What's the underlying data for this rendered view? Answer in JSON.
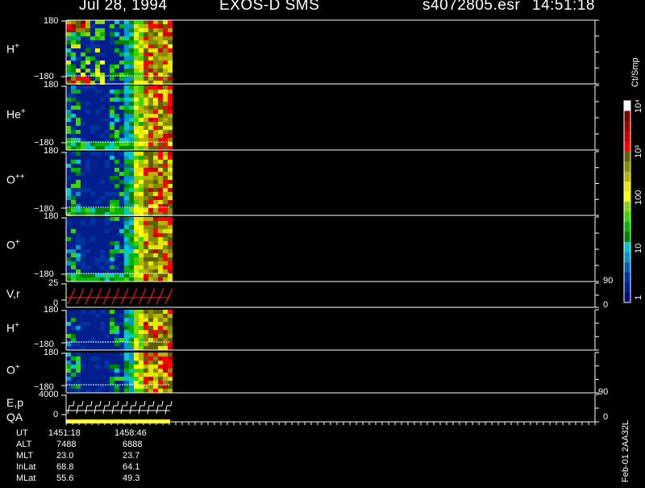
{
  "header": {
    "date": "Jul 28, 1994",
    "instrument": "EXOS-D SMS",
    "file": "s4072805.esr",
    "time": "14:51:18"
  },
  "panels": [
    {
      "id": "h-plus",
      "species": "H",
      "charge": "+",
      "y_top": "180",
      "y_bottom": "−180"
    },
    {
      "id": "he-plus",
      "species": "He",
      "charge": "+",
      "y_top": "180",
      "y_bottom": "−180"
    },
    {
      "id": "o-plusplus",
      "species": "O",
      "charge": "++",
      "y_top": "180",
      "y_bottom": "−180"
    },
    {
      "id": "o-plus",
      "species": "O",
      "charge": "+",
      "y_top": "180",
      "y_bottom": "−180",
      "right_tick": "90"
    },
    {
      "id": "vr",
      "species": "V,r",
      "charge": "",
      "y_top": "25",
      "y_bottom": "0",
      "right_tick": "0"
    },
    {
      "id": "h-plus-2",
      "species": "H",
      "charge": "+",
      "y_top": "180",
      "y_bottom": "−180"
    },
    {
      "id": "o-plus-2",
      "species": "O",
      "charge": "+",
      "y_top": "180",
      "y_bottom": "−180",
      "right_tick": "90"
    },
    {
      "id": "ep-qa",
      "species": "E,p",
      "species2": "QA",
      "charge": "",
      "y_top": "4000",
      "y_bottom": "0",
      "right_tick": "0"
    }
  ],
  "colorbar": {
    "unit": "Ct/Smp",
    "tick_labels": [
      "10⁴",
      "10³",
      "100",
      "10",
      "1"
    ],
    "colors": [
      "#ffffff",
      "#7a0000",
      "#a00000",
      "#c80000",
      "#ff0000",
      "#606000",
      "#8a8a00",
      "#b4b400",
      "#e6e600",
      "#ffff00",
      "#8ad400",
      "#3cd400",
      "#00b400",
      "#008200",
      "#00c8c8",
      "#0096c8",
      "#0064b4",
      "#0032a0",
      "#001e8c",
      "#000a78"
    ]
  },
  "footer": {
    "rows": [
      {
        "label": "UT",
        "v1": "1451:18",
        "v2": "1458:46"
      },
      {
        "label": "ALT",
        "v1": "7488",
        "v2": "6888"
      },
      {
        "label": "MLT",
        "v1": "23.0",
        "v2": "23.7"
      },
      {
        "label": "InLat",
        "v1": "68.8",
        "v2": "64.1"
      },
      {
        "label": "MLat",
        "v1": "55.6",
        "v2": "49.3"
      }
    ],
    "stamp": "Feb-01 2AA32L"
  },
  "chart_data": {
    "type": "heatmap",
    "title": "Jul 28, 1994   EXOS-D SMS",
    "x_ticks": [
      "1451:18",
      "1458:46"
    ],
    "colorscale": {
      "unit": "Ct/Smp",
      "min": 1,
      "max": 10000,
      "log": true
    },
    "data_coverage_fraction": 0.2,
    "panels": [
      "H+",
      "He+",
      "O++",
      "O+",
      "V,r",
      "H+",
      "O+",
      "E,p QA"
    ]
  }
}
